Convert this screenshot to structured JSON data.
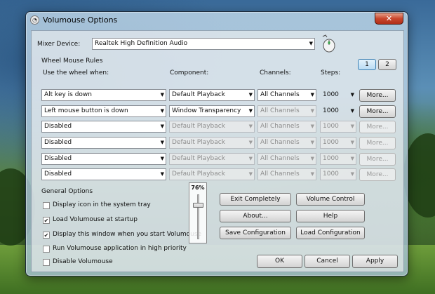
{
  "window": {
    "title": "Volumouse Options",
    "close_label": "✕"
  },
  "mixer": {
    "label": "Mixer Device:",
    "device": "Realtek High Definition Audio",
    "pages": [
      "1",
      "2"
    ]
  },
  "rules": {
    "section_title": "Wheel Mouse Rules",
    "headers": {
      "use": "Use the wheel when:",
      "component": "Component:",
      "channels": "Channels:",
      "steps": "Steps:"
    },
    "rows": [
      {
        "use": "Alt key is down",
        "component": "Default Playback",
        "channels": "All Channels",
        "steps": "1000",
        "more": "More...",
        "enabled": true
      },
      {
        "use": "Left mouse button is down",
        "component": "Window Transparency",
        "channels": "All Channels",
        "steps": "1000",
        "more": "More...",
        "enabled": true
      },
      {
        "use": "Disabled",
        "component": "Default Playback",
        "channels": "All Channels",
        "steps": "1000",
        "more": "More...",
        "enabled": false
      },
      {
        "use": "Disabled",
        "component": "Default Playback",
        "channels": "All Channels",
        "steps": "1000",
        "more": "More...",
        "enabled": false
      },
      {
        "use": "Disabled",
        "component": "Default Playback",
        "channels": "All Channels",
        "steps": "1000",
        "more": "More...",
        "enabled": false
      },
      {
        "use": "Disabled",
        "component": "Default Playback",
        "channels": "All Channels",
        "steps": "1000",
        "more": "More...",
        "enabled": false
      }
    ]
  },
  "general": {
    "section_title": "General Options",
    "options": [
      {
        "label": "Display icon in the system tray",
        "checked": false
      },
      {
        "label": "Load Volumouse at startup",
        "checked": true
      },
      {
        "label": "Display this window when you start Volumouse",
        "checked": true
      },
      {
        "label": "Run Volumouse application in high priority",
        "checked": false
      },
      {
        "label": "Disable Volumouse",
        "checked": false
      }
    ]
  },
  "transparency": {
    "value_label": "76%",
    "level_fraction": 0.76
  },
  "actions": {
    "exit": "Exit Completely",
    "volume_control": "Volume Control",
    "about": "About...",
    "help": "Help",
    "save": "Save Configuration",
    "load": "Load Configuration"
  },
  "footer": {
    "ok": "OK",
    "cancel": "Cancel",
    "apply": "Apply"
  }
}
